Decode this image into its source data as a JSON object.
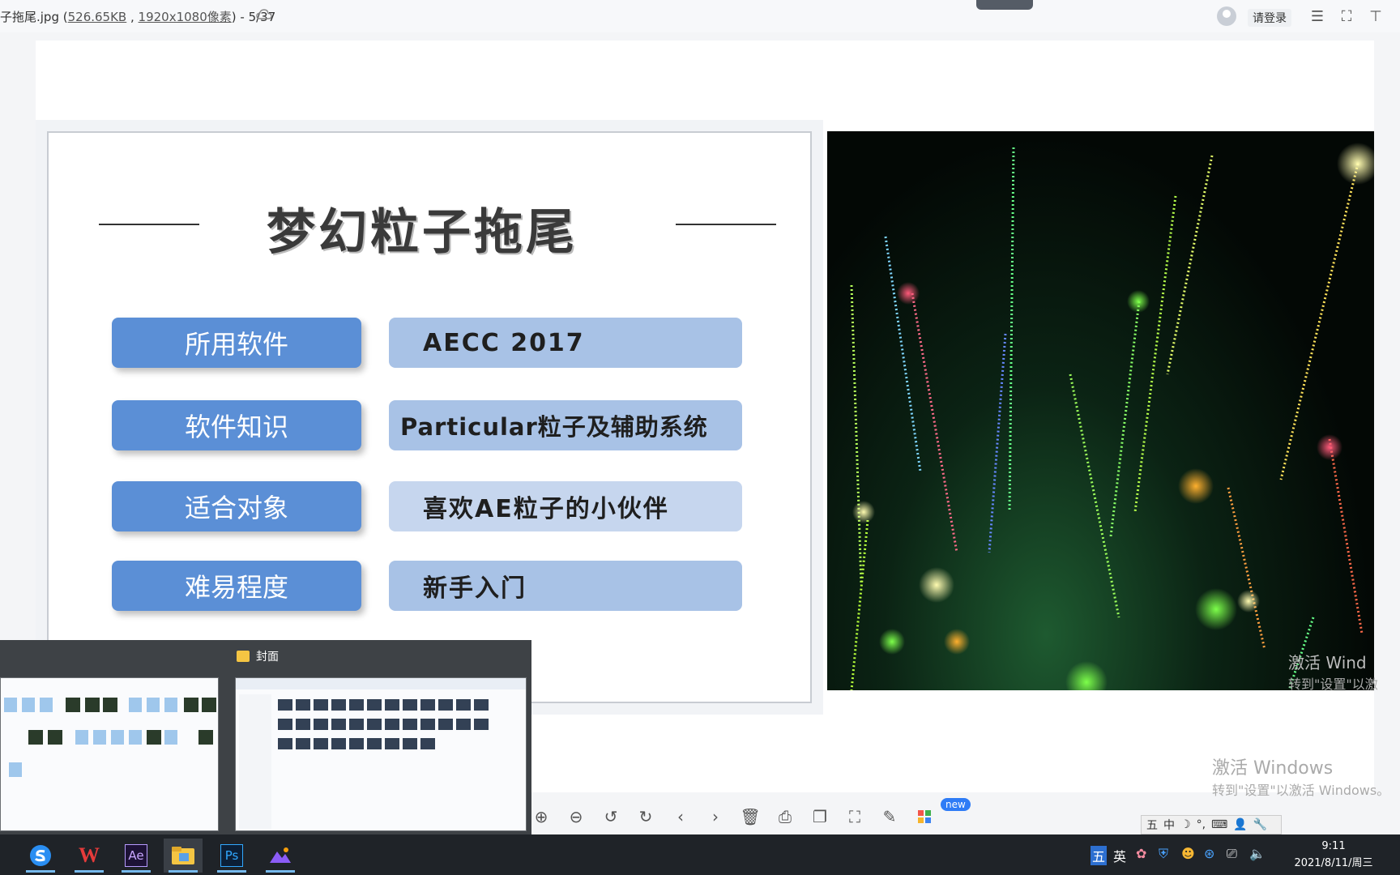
{
  "titlebar": {
    "filename_prefix": "子拖尾.jpg (",
    "filesize": "526.65KB",
    "separator": " , ",
    "dimensions": "1920x1080像素",
    "page_suffix": ") - 5/37",
    "login_label": "请登录"
  },
  "slide": {
    "title": "梦幻粒子拖尾",
    "rows": [
      {
        "label": "所用软件",
        "value": "AECC 2017"
      },
      {
        "label": "软件知识",
        "value": "Particular粒子及辅助系统"
      },
      {
        "label": "适合对象",
        "value": "喜欢AE粒子的小伙伴"
      },
      {
        "label": "难易程度",
        "value": "新手入门"
      }
    ],
    "colors": {
      "label_bg": "#5b8fd6",
      "value_dark": "#a8c2e6",
      "value_light": "#c6d6ee"
    }
  },
  "watermark": {
    "small_line1": "激活 Wind",
    "small_line2": "转到\"设置\"以激",
    "line1": "激活 Windows",
    "line2": "转到\"设置\"以激活 Windows。"
  },
  "toolbar": {
    "icons": [
      "zoom-in-icon",
      "zoom-out-icon",
      "rotate-left-icon",
      "rotate-right-icon",
      "previous-icon",
      "next-icon",
      "delete-icon",
      "print-icon",
      "copy-icon",
      "screenshot-icon",
      "edit-icon",
      "apps-icon"
    ],
    "new_badge": "new"
  },
  "ime": {
    "items": [
      "五",
      "中",
      "☽",
      "°,",
      "⌨",
      "👤",
      "🔧"
    ]
  },
  "preview": {
    "title": "封面"
  },
  "taskbar": {
    "apps": [
      "sogou-browser",
      "wps",
      "after-effects",
      "file-explorer",
      "photoshop",
      "image-viewer"
    ],
    "ae_label": "Ae",
    "ps_label": "Ps",
    "wps_label": "W",
    "tray_ime": "五",
    "tray_lang": "英",
    "time": "9:11",
    "date": "2021/8/11/周三"
  }
}
